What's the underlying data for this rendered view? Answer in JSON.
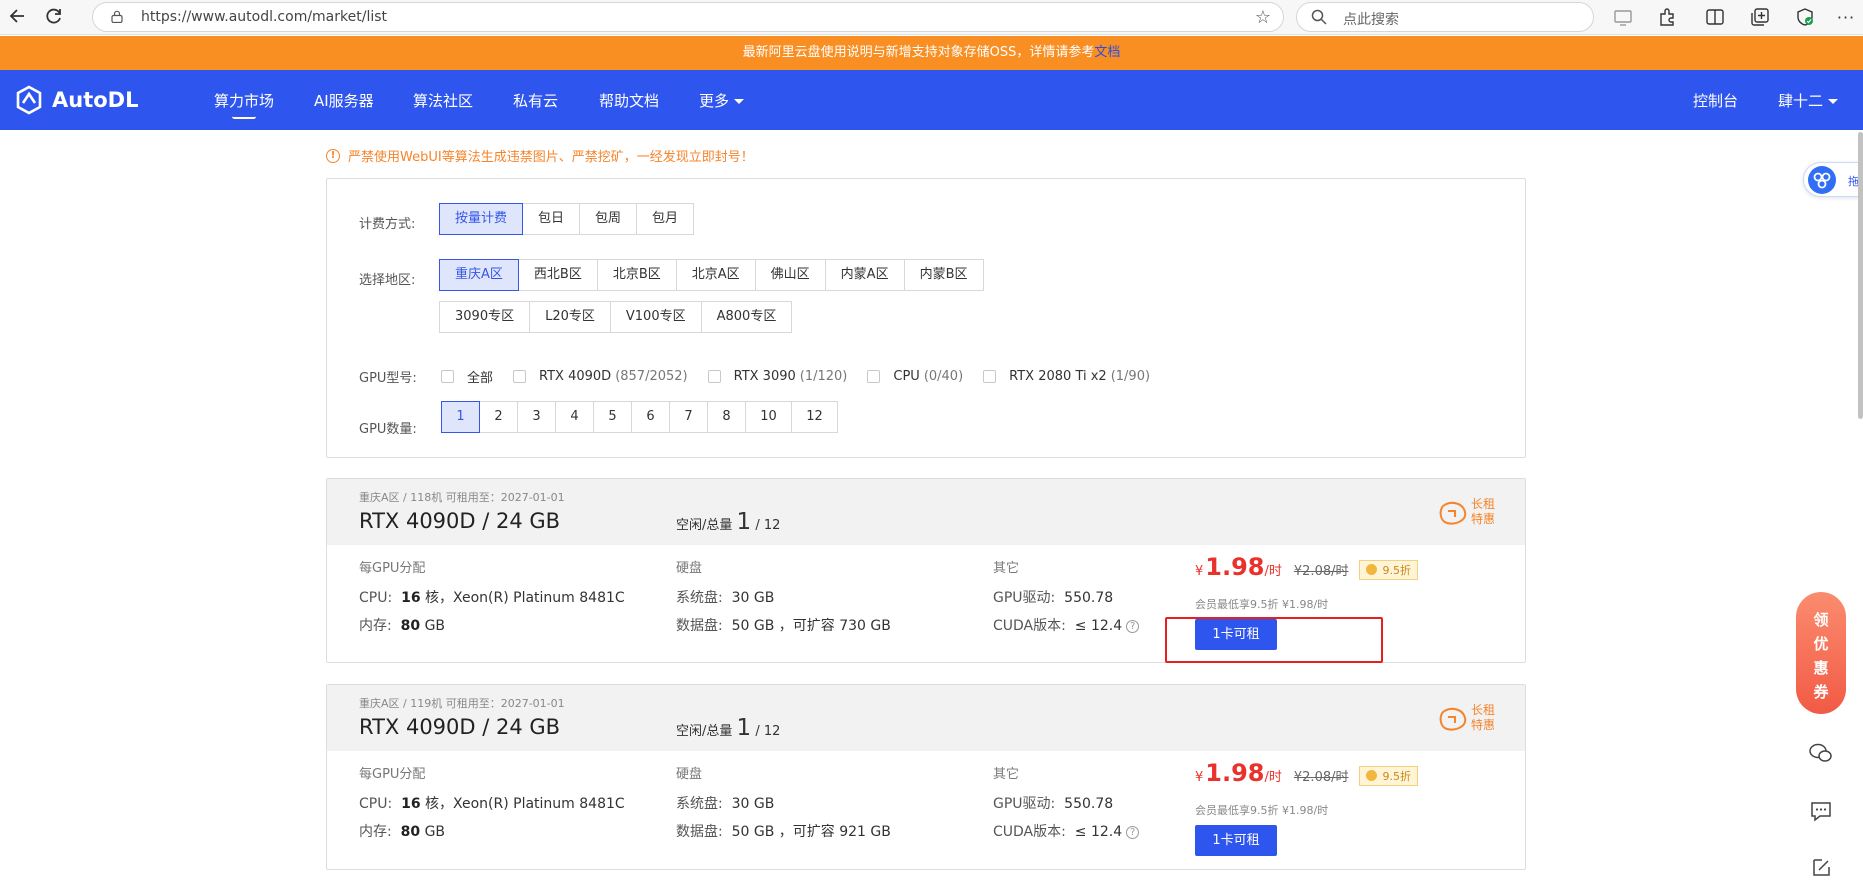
{
  "browser": {
    "url": "https://www.autodl.com/market/list",
    "search_placeholder": "点此搜索"
  },
  "notice": {
    "text": "最新阿里云盘使用说明与新增支持对象存储OSS，详情请参考",
    "link": "文档"
  },
  "nav": {
    "logo": "AutoDL",
    "items": [
      "算力市场",
      "AI服务器",
      "算法社区",
      "私有云",
      "帮助文档",
      "更多"
    ],
    "console": "控制台",
    "user": "肆十二"
  },
  "warning": "严禁使用WebUI等算法生成违禁图片、严禁挖矿，一经发现立即封号！",
  "filters": {
    "billing_label": "计费方式:",
    "billing_options": [
      "按量计费",
      "包日",
      "包周",
      "包月"
    ],
    "region_label": "选择地区:",
    "regions_row1": [
      "重庆A区",
      "西北B区",
      "北京B区",
      "北京A区",
      "佛山区",
      "内蒙A区",
      "内蒙B区"
    ],
    "regions_row2": [
      "3090专区",
      "L20专区",
      "V100专区",
      "A800专区"
    ],
    "gpu_label": "GPU型号:",
    "gpu_options": [
      {
        "name": "全部",
        "count": ""
      },
      {
        "name": "RTX 4090D",
        "count": "(857/2052)"
      },
      {
        "name": "RTX 3090",
        "count": "(1/120)"
      },
      {
        "name": "CPU",
        "count": "(0/40)"
      },
      {
        "name": "RTX 2080 Ti x2",
        "count": "(1/90)"
      }
    ],
    "count_label": "GPU数量:",
    "count_options": [
      "1",
      "2",
      "3",
      "4",
      "5",
      "6",
      "7",
      "8",
      "10",
      "12"
    ]
  },
  "cards": [
    {
      "meta": "重庆A区 / 118机   可租用至：2027-01-01",
      "gpu": "RTX 4090D / 24 GB",
      "idle_label": "空闲/总量",
      "idle": "1",
      "total": "/ 12",
      "badge1": "长租",
      "badge2": "特惠",
      "h_alloc": "每GPU分配",
      "h_disk": "硬盘",
      "h_other": "其它",
      "cpu_k": "CPU:",
      "cpu_n": "16",
      "cpu_v": "核，Xeon(R) Platinum 8481C",
      "mem_k": "内存:",
      "mem_n": "80",
      "mem_v": "GB",
      "sys_k": "系统盘:",
      "sys_v": "30 GB",
      "data_k": "数据盘:",
      "data_v": "50 GB ，可扩容 730 GB",
      "drv_k": "GPU驱动:",
      "drv_v": "550.78",
      "cuda_k": "CUDA版本:",
      "cuda_v": "≤ 12.4",
      "cur": "¥",
      "price": "1.98",
      "unit": "/时",
      "old": "¥2.08/时",
      "discount": "9.5折",
      "member": "会员最低享9.5折 ¥1.98/时",
      "rent": "1卡可租"
    },
    {
      "meta": "重庆A区 / 119机   可租用至：2027-01-01",
      "gpu": "RTX 4090D / 24 GB",
      "idle_label": "空闲/总量",
      "idle": "1",
      "total": "/ 12",
      "badge1": "长租",
      "badge2": "特惠",
      "h_alloc": "每GPU分配",
      "h_disk": "硬盘",
      "h_other": "其它",
      "cpu_k": "CPU:",
      "cpu_n": "16",
      "cpu_v": "核，Xeon(R) Platinum 8481C",
      "mem_k": "内存:",
      "mem_n": "80",
      "mem_v": "GB",
      "sys_k": "系统盘:",
      "sys_v": "30 GB",
      "data_k": "数据盘:",
      "data_v": "50 GB ，可扩容 921 GB",
      "drv_k": "GPU驱动:",
      "drv_v": "550.78",
      "cuda_k": "CUDA版本:",
      "cuda_v": "≤ 12.4",
      "cur": "¥",
      "price": "1.98",
      "unit": "/时",
      "old": "¥2.08/时",
      "discount": "9.5折",
      "member": "会员最低享9.5折 ¥1.98/时",
      "rent": "1卡可租"
    }
  ],
  "floating": {
    "pill_text": "拖",
    "coupon": [
      "领",
      "优",
      "惠",
      "券"
    ]
  }
}
